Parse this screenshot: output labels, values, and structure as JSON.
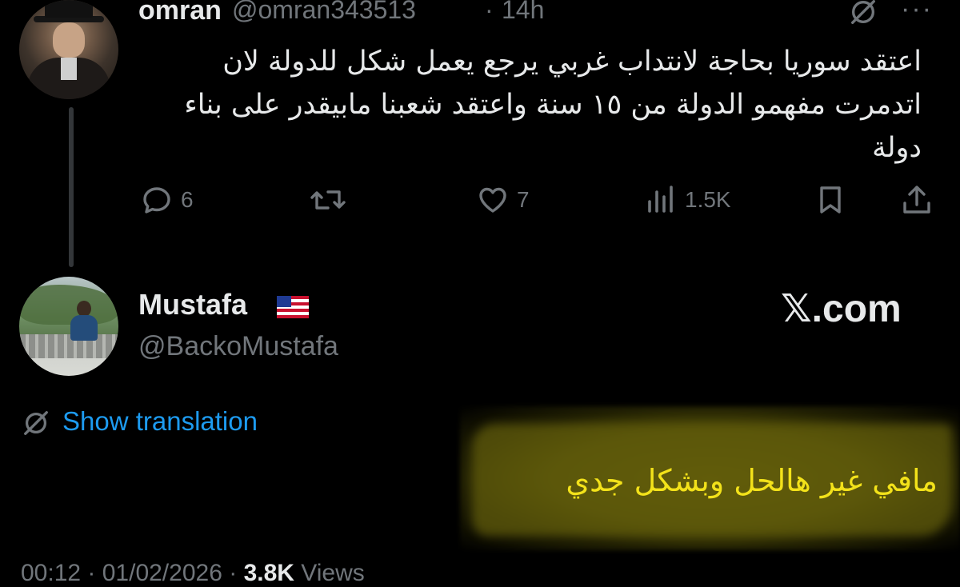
{
  "tweet": {
    "author_name": "omran",
    "author_handle": "@omran343513",
    "separator": "·",
    "time": "14h",
    "more_label": "···",
    "text": "اعتقد سوريا بحاجة لانتداب غربي يرجع يعمل شكل للدولة لان اتدمرت مفهمو الدولة من ١٥ سنة واعتقد شعبنا مابيقدر على بناء دولة",
    "stats": {
      "replies": "6",
      "likes": "7",
      "views": "1.5K"
    }
  },
  "reply": {
    "author_name": "Mustafa",
    "author_handle": "@BackoMustafa",
    "watermark": "𝕏.com",
    "translation_label": "Show translation",
    "text": "مافي غير هالحل وبشكل جدي",
    "footer_time": "00:12 · 01/02/2026 ·",
    "footer_views": "3.8K",
    "footer_views_label": "Views"
  },
  "icons": {
    "reply": "reply-icon",
    "retweet": "retweet-icon",
    "like": "heart-icon",
    "views": "views-icon",
    "bookmark": "bookmark-icon",
    "share": "share-icon",
    "grok": "grok-icon",
    "flag": "us-flag-icon",
    "translate": "translate-icon"
  },
  "colors": {
    "background": "#000000",
    "text": "#e7e9ea",
    "muted": "#71767b",
    "link": "#1d9bf0",
    "highlight_text": "#f3e21a"
  }
}
